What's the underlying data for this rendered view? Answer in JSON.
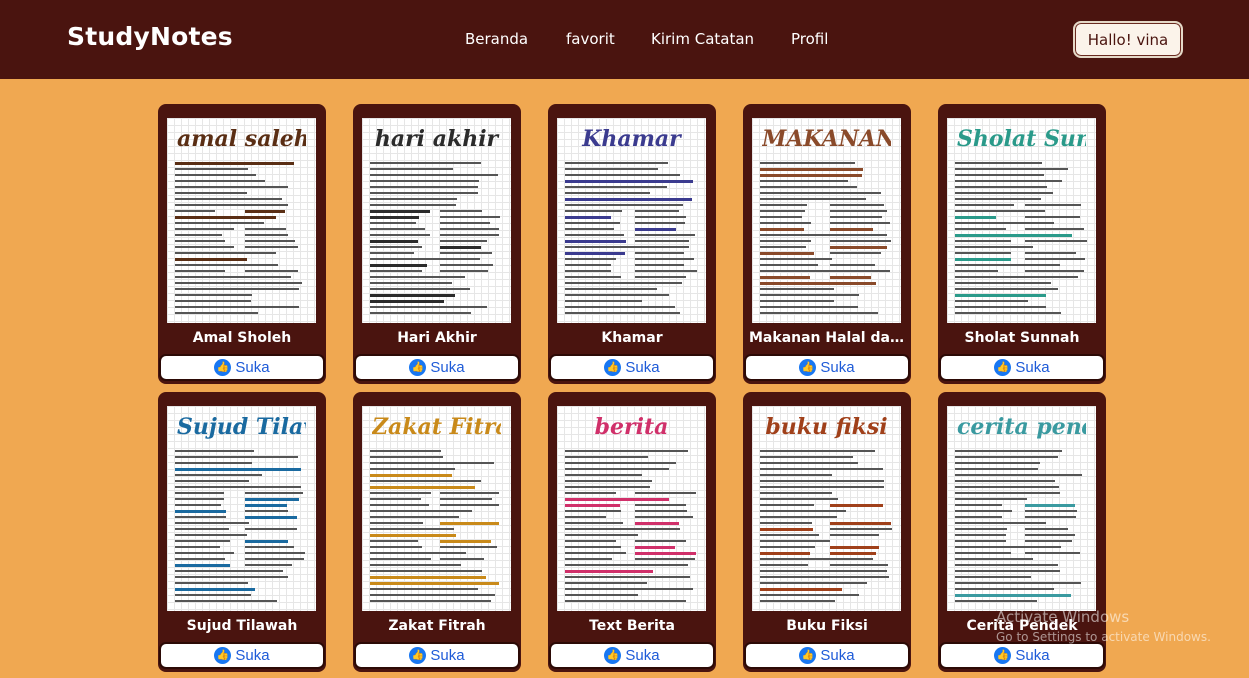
{
  "navbar": {
    "brand": "StudyNotes",
    "links": [
      "Beranda",
      "favorit",
      "Kirim Catatan",
      "Profil"
    ],
    "user_button": "Hallo! vina"
  },
  "cards": [
    {
      "title": "Amal Sholeh",
      "thumb_heading": "amal saleh",
      "accent": "#5a2e14",
      "like_label": "Suka"
    },
    {
      "title": "Hari Akhir",
      "thumb_heading": "hari akhir",
      "accent": "#2b2b2b",
      "like_label": "Suka"
    },
    {
      "title": "Khamar",
      "thumb_heading": "Khamar",
      "accent": "#3b3b8f",
      "like_label": "Suka"
    },
    {
      "title": "Makanan Halal da...",
      "thumb_heading": "MAKANAN halal haram",
      "accent": "#8a4a2a",
      "like_label": "Suka"
    },
    {
      "title": "Sholat Sunnah",
      "thumb_heading": "Sholat Sunnah",
      "accent": "#2a9a8a",
      "like_label": "Suka"
    },
    {
      "title": "Sujud Tilawah",
      "thumb_heading": "Sujud Tilawah",
      "accent": "#1a6aa0",
      "like_label": "Suka"
    },
    {
      "title": "Zakat Fitrah",
      "thumb_heading": "Zakat Fitrah",
      "accent": "#c98a1a",
      "like_label": "Suka"
    },
    {
      "title": "Text Berita",
      "thumb_heading": "berita",
      "accent": "#d0306a",
      "like_label": "Suka"
    },
    {
      "title": "Buku Fiksi",
      "thumb_heading": "buku fiksi",
      "accent": "#a0401a",
      "like_label": "Suka"
    },
    {
      "title": "Cerita Pendek",
      "thumb_heading": "cerita pendek",
      "accent": "#3a9aa0",
      "like_label": "Suka"
    }
  ],
  "watermark": {
    "title": "Activate Windows",
    "subtitle": "Go to Settings to activate Windows."
  }
}
